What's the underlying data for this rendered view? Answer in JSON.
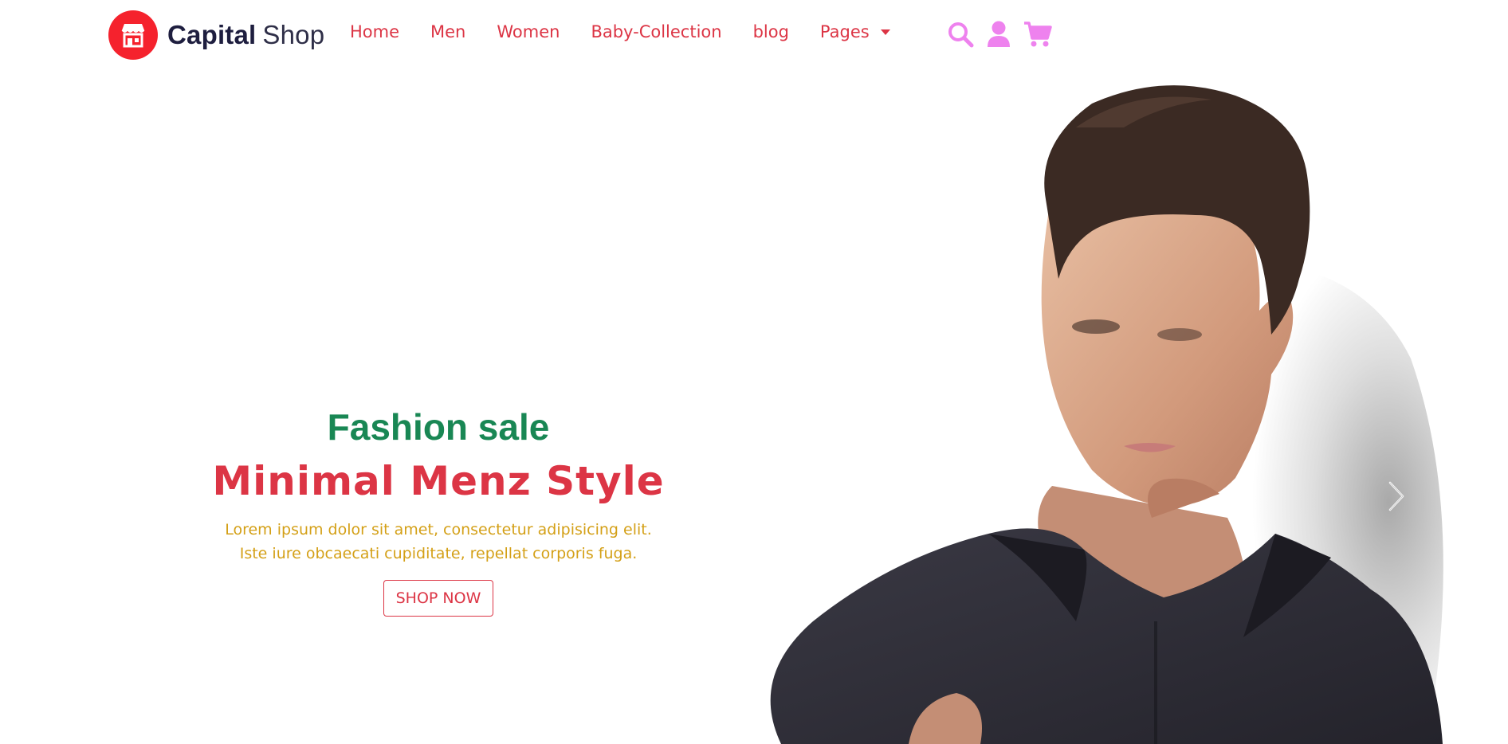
{
  "colors": {
    "brand_red": "#f5222d",
    "nav_text": "#dc3545",
    "icon_pink": "#ee82ee",
    "hero_subtitle": "#198754",
    "hero_title": "#dc3545",
    "hero_description": "#d4a017"
  },
  "logo": {
    "icon": "storefront-icon",
    "strong": "Capital",
    "light": "Shop"
  },
  "nav": {
    "items": [
      {
        "label": "Home"
      },
      {
        "label": "Men"
      },
      {
        "label": "Women"
      },
      {
        "label": "Baby-Collection"
      },
      {
        "label": "blog"
      }
    ],
    "pages_label": "Pages",
    "pages_icon": "caret-down-icon"
  },
  "header_icons": [
    "search-icon",
    "user-icon",
    "cart-icon"
  ],
  "hero": {
    "subtitle": "Fashion sale",
    "title": "Minimal Menz Style",
    "description": "Lorem ipsum dolor sit amet, consectetur adipisicing elit. Iste iure obcaecati cupiditate, repellat corporis fuga.",
    "button_label": "SHOP NOW",
    "image": "man-in-dark-shirt-photo",
    "next_icon": "chevron-right-icon"
  }
}
